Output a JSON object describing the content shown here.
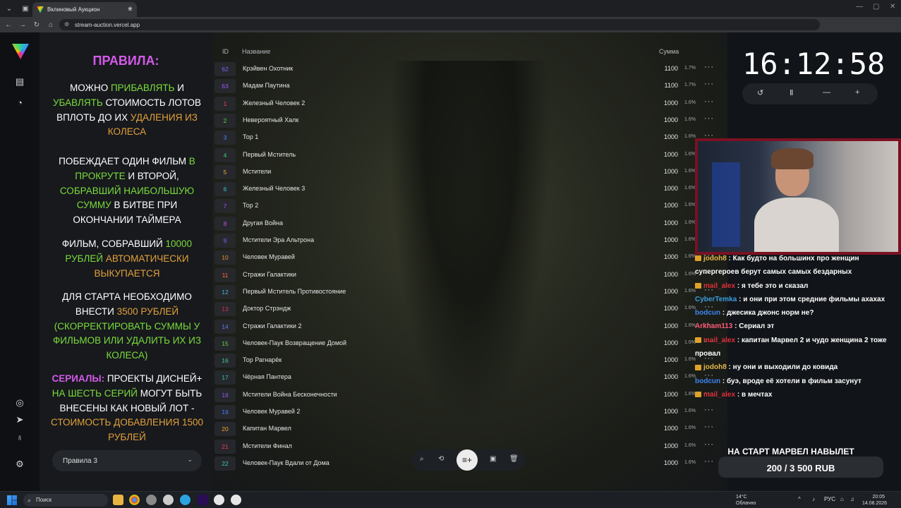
{
  "browser": {
    "tab_title": "Вклиновый Аукцион",
    "url": "stream-auction.vercel.app"
  },
  "rules": {
    "title": "ПРАВИЛА:",
    "p1": [
      {
        "t": "МОЖНО ",
        "c": ""
      },
      {
        "t": "ПРИБАВЛЯТЬ",
        "c": "g"
      },
      {
        "t": " И ",
        "c": ""
      },
      {
        "t": "УБАВЛЯТЬ",
        "c": "g"
      },
      {
        "t": " СТОИМОСТЬ ЛОТОВ ВПЛОТЬ ДО ИХ ",
        "c": ""
      },
      {
        "t": "УДАЛЕНИЯ ИЗ КОЛЕСА",
        "c": "o"
      }
    ],
    "p2": [
      {
        "t": "ПОБЕЖДАЕТ ОДИН ФИЛЬМ ",
        "c": ""
      },
      {
        "t": "В ПРОКРУТЕ",
        "c": "g"
      },
      {
        "t": " И ВТОРОЙ, ",
        "c": ""
      },
      {
        "t": "СОБРАВШИЙ НАИБОЛЬШУЮ СУММУ",
        "c": "g"
      },
      {
        "t": " В БИТВЕ ПРИ ОКОНЧАНИИ ТАЙМЕРА",
        "c": ""
      }
    ],
    "p3": [
      {
        "t": "ФИЛЬМ, СОБРАВШИЙ ",
        "c": ""
      },
      {
        "t": "10000 РУБЛЕЙ",
        "c": "g"
      },
      {
        "t": " ",
        "c": ""
      },
      {
        "t": "АВТОМАТИЧЕСКИ ВЫКУПАЕТСЯ",
        "c": "o"
      }
    ],
    "p4": [
      {
        "t": "ДЛЯ СТАРТА НЕОБХОДИМО ВНЕСТИ ",
        "c": ""
      },
      {
        "t": "3500 РУБЛЕЙ",
        "c": "o"
      },
      {
        "t": " ",
        "c": ""
      },
      {
        "t": "(СКОРРЕКТИРОВАТЬ СУММЫ У ФИЛЬМОВ ИЛИ УДАЛИТЬ ИХ ИЗ КОЛЕСА)",
        "c": "g"
      }
    ],
    "p5": [
      {
        "t": "СЕРИАЛЫ:",
        "c": "p"
      },
      {
        "t": " ПРОЕКТЫ ДИСНЕЙ+ ",
        "c": ""
      },
      {
        "t": "НА ШЕСТЬ СЕРИЙ",
        "c": "g"
      },
      {
        "t": " МОГУТ БЫТЬ ВНЕСЕНЫ КАК НОВЫЙ ЛОТ - ",
        "c": ""
      },
      {
        "t": "СТОИМОСТЬ ДОБАВЛЕНИЯ 1500 РУБЛЕЙ",
        "c": "o"
      }
    ],
    "select_value": "Правила 3"
  },
  "table": {
    "col_id": "ID",
    "col_name": "Название",
    "col_sum": "Сумма",
    "rows": [
      {
        "id": "62",
        "name": "Крэйвен Охотник",
        "sum": "1100",
        "pct": "1.7%",
        "color": "#7c64ff"
      },
      {
        "id": "63",
        "name": "Мадам Паутина",
        "sum": "1100",
        "pct": "1.7%",
        "color": "#9b59ff"
      },
      {
        "id": "1",
        "name": "Железный Человек 2",
        "sum": "1000",
        "pct": "1.6%",
        "color": "#ff3b5c"
      },
      {
        "id": "2",
        "name": "Невероятный Халк",
        "sum": "1000",
        "pct": "1.6%",
        "color": "#55d84a"
      },
      {
        "id": "3",
        "name": "Тор 1",
        "sum": "1000",
        "pct": "1.6%",
        "color": "#3f8dff"
      },
      {
        "id": "4",
        "name": "Первый Мститель",
        "sum": "1000",
        "pct": "1.6%",
        "color": "#3ccf6e"
      },
      {
        "id": "5",
        "name": "Мстители",
        "sum": "1000",
        "pct": "1.6%",
        "color": "#f2a833"
      },
      {
        "id": "6",
        "name": "Железный Человек 3",
        "sum": "1000",
        "pct": "1.6%",
        "color": "#35c9c9"
      },
      {
        "id": "7",
        "name": "Тор 2",
        "sum": "1000",
        "pct": "1.6%",
        "color": "#a04cff"
      },
      {
        "id": "8",
        "name": "Другая Война",
        "sum": "1000",
        "pct": "1.6%",
        "color": "#c14fe0"
      },
      {
        "id": "9",
        "name": "Мстители Эра Альтрона",
        "sum": "1000",
        "pct": "1.6%",
        "color": "#8a5cff"
      },
      {
        "id": "10",
        "name": "Человек Муравей",
        "sum": "1000",
        "pct": "1.6%",
        "color": "#f28c2a"
      },
      {
        "id": "11",
        "name": "Стражи Галактики",
        "sum": "1000",
        "pct": "1.6%",
        "color": "#ff6a3d"
      },
      {
        "id": "12",
        "name": "Первый Мститель Противостояние",
        "sum": "1000",
        "pct": "1.6%",
        "color": "#3fb6d8"
      },
      {
        "id": "13",
        "name": "Доктор Стрэндж",
        "sum": "1000",
        "pct": "1.6%",
        "color": "#d8304a"
      },
      {
        "id": "14",
        "name": "Стражи Галактики 2",
        "sum": "1000",
        "pct": "1.6%",
        "color": "#5a7dff"
      },
      {
        "id": "15",
        "name": "Человек-Паук Возвращение Домой",
        "sum": "1000",
        "pct": "1.6%",
        "color": "#6fd040"
      },
      {
        "id": "16",
        "name": "Тор Рагнарёк",
        "sum": "1000",
        "pct": "1.6%",
        "color": "#3ccf8e"
      },
      {
        "id": "17",
        "name": "Чёрная Пантера",
        "sum": "1000",
        "pct": "1.6%",
        "color": "#32c0b8"
      },
      {
        "id": "18",
        "name": "Мстители Война Бесконечности",
        "sum": "1000",
        "pct": "1.6%",
        "color": "#8e56e8"
      },
      {
        "id": "19",
        "name": "Человек Муравей 2",
        "sum": "1000",
        "pct": "1.6%",
        "color": "#4c7bff"
      },
      {
        "id": "20",
        "name": "Капитан Марвел",
        "sum": "1000",
        "pct": "1.6%",
        "color": "#f2a833"
      },
      {
        "id": "21",
        "name": "Мстители Финал",
        "sum": "1000",
        "pct": "1.6%",
        "color": "#ff3b5c"
      },
      {
        "id": "22",
        "name": "Человек-Паук Вдали от Дома",
        "sum": "1000",
        "pct": "1.6%",
        "color": "#3cc8b0"
      }
    ]
  },
  "timer": "16:12:58",
  "chat": [
    {
      "user": "jodoh8",
      "cls": "u-gold",
      "badge": true,
      "msg": "Как будто на большинх про женщин супергероев берут самых самых бездарных"
    },
    {
      "user": "mail_alex",
      "cls": "u-red",
      "badge": true,
      "msg": "я тебе это и сказал"
    },
    {
      "user": "CyberTemka",
      "cls": "u-teal",
      "badge": false,
      "msg": "и они при этом средние фильмы ахахах"
    },
    {
      "user": "bodcun",
      "cls": "u-blue",
      "badge": false,
      "msg": "джесика джонс норм не?"
    },
    {
      "user": "Arkham113",
      "cls": "u-pink",
      "badge": false,
      "msg": "Сериал эт"
    },
    {
      "user": "mail_alex",
      "cls": "u-red",
      "badge": true,
      "msg": "капитан Марвел 2 и чудо женщина 2 тоже провал"
    },
    {
      "user": "jodoh8",
      "cls": "u-gold",
      "badge": true,
      "msg": "ну они и выходили до ковида"
    },
    {
      "user": "bodcun",
      "cls": "u-blue",
      "badge": false,
      "msg": "буэ, вроде её хотели в фильм засунут"
    },
    {
      "user": "mail_alex",
      "cls": "u-red",
      "badge": true,
      "msg": "в мечтах"
    }
  ],
  "stream_overlay": {
    "line1": "НА СТАРТ МАРВЕЛ НАВЫЛЕТ",
    "line2": "200 / 3 500 RUB"
  },
  "taskbar": {
    "search_placeholder": "Поиск",
    "weather_temp": "14°C",
    "weather_desc": "Облачно",
    "lang": "РУС",
    "time": "20:05",
    "date": "14.08.2026"
  }
}
